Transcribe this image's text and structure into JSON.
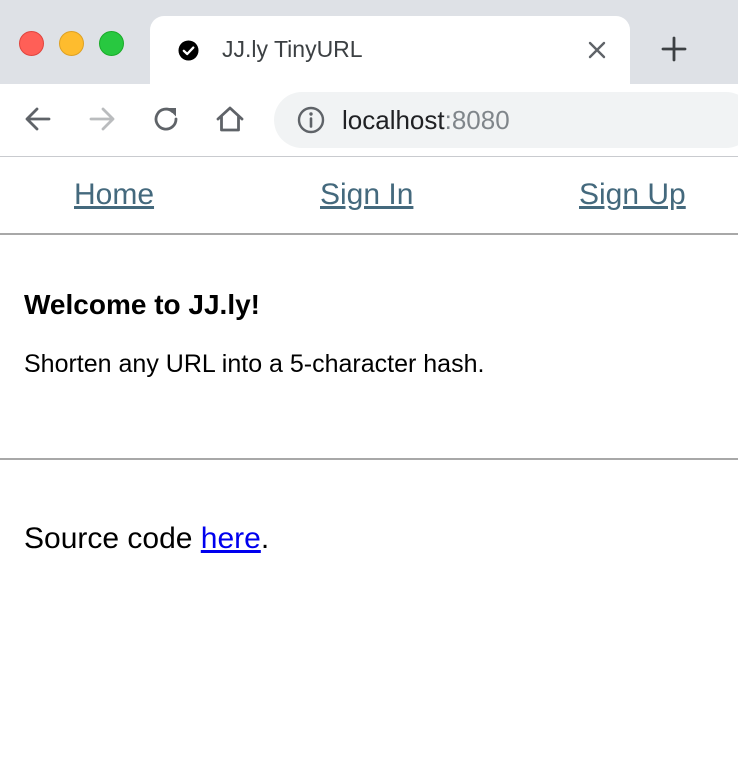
{
  "browser": {
    "tab_title": "JJ.ly TinyURL",
    "url_host": "localhost",
    "url_port": ":8080",
    "icons": [
      "close-traffic-light",
      "minimize-traffic-light",
      "zoom-traffic-light",
      "check-circle-icon",
      "close-icon",
      "plus-icon",
      "back-arrow-icon",
      "forward-arrow-icon",
      "reload-icon",
      "home-icon",
      "info-icon"
    ],
    "colors": {
      "tabstrip": "#dee1e6",
      "omnibox": "#f1f3f4",
      "red": "#ff5f57",
      "yellow": "#febc2e",
      "green": "#28c840"
    }
  },
  "nav": {
    "home": "Home",
    "sign_in": "Sign In",
    "sign_up": "Sign Up",
    "link_color": "#44697d"
  },
  "hero": {
    "title": "Welcome to JJ.ly!",
    "subtitle": "Shorten any URL into a 5-character hash."
  },
  "footer": {
    "prefix": "Source code ",
    "link": "here",
    "suffix": "."
  }
}
